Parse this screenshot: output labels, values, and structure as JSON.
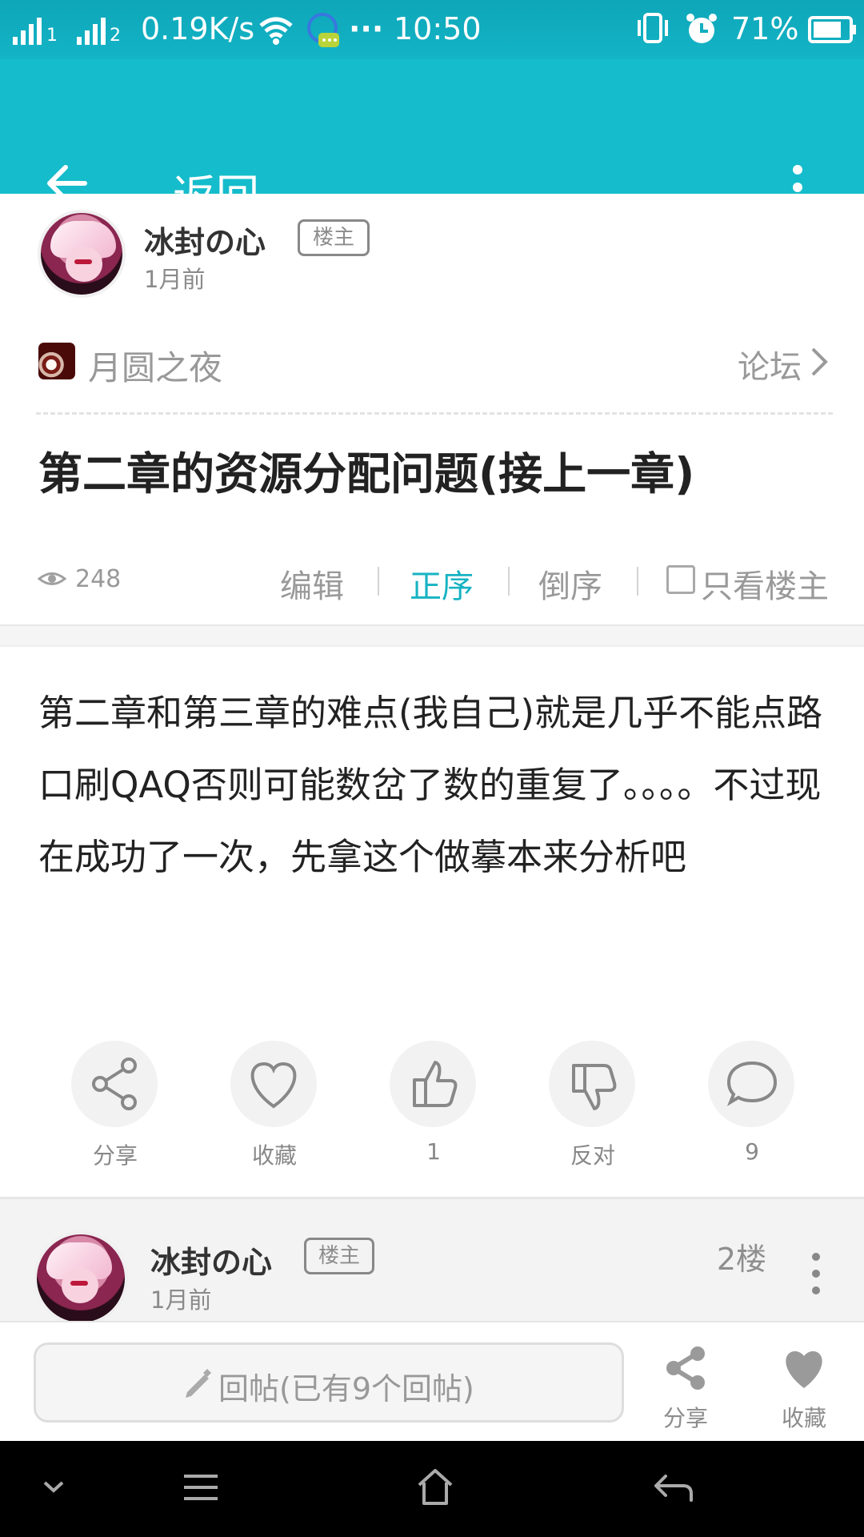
{
  "status_bar": {
    "signal_1": "1",
    "signal_2": "2",
    "speed": "0.19K/s",
    "dots": "···",
    "time": "10:50",
    "battery": "71%",
    "icons": [
      "signal-icon",
      "wifi-icon",
      "notification-icon",
      "vibrate-icon",
      "alarm-icon",
      "battery-icon"
    ]
  },
  "app_bar": {
    "back_label": "返回"
  },
  "author": {
    "name": "冰封の心",
    "badge": "楼主",
    "time": "1月前"
  },
  "forum": {
    "name": "月圆之夜",
    "link": "论坛"
  },
  "post": {
    "title": "第二章的资源分配问题(接上一章)",
    "views": "248",
    "controls": {
      "edit": "编辑",
      "ascending": "正序",
      "descending": "倒序",
      "only_author": "只看楼主"
    },
    "content": "第二章和第三章的难点(我自己)就是几乎不能点路口刷QAQ否则可能数岔了数的重复了。。。。不过现在成功了一次，先拿这个做摹本来分析吧"
  },
  "actions": [
    {
      "label": "分享",
      "icon": "share-icon"
    },
    {
      "label": "收藏",
      "icon": "heart-icon"
    },
    {
      "label": "1",
      "icon": "thumbs-up-icon"
    },
    {
      "label": "反对",
      "icon": "thumbs-down-icon"
    },
    {
      "label": "9",
      "icon": "comment-icon"
    }
  ],
  "reply_preview": {
    "name": "冰封の心",
    "badge": "楼主",
    "time": "1月前",
    "floor": "2楼"
  },
  "bottom_bar": {
    "reply_placeholder": "回帖(已有9个回帖)",
    "share_label": "分享",
    "favorite_label": "收藏"
  },
  "colors": {
    "accent": "#15bccb",
    "text": "#222222",
    "muted": "#999999"
  }
}
